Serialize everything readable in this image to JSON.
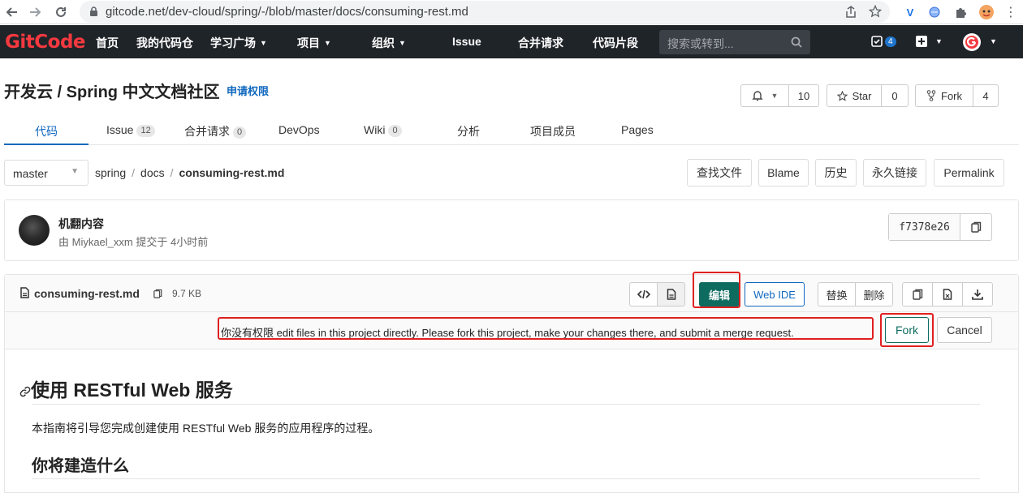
{
  "browser": {
    "url": "gitcode.net/dev-cloud/spring/-/blob/master/docs/consuming-rest.md"
  },
  "header": {
    "logo": "GitCode",
    "nav": [
      {
        "label": "首页",
        "dropdown": false
      },
      {
        "label": "我的代码仓",
        "dropdown": false
      },
      {
        "label": "学习广场",
        "dropdown": true
      },
      {
        "label": "项目",
        "dropdown": true
      },
      {
        "label": "组织",
        "dropdown": true
      },
      {
        "label": "Issue",
        "dropdown": false
      },
      {
        "label": "合并请求",
        "dropdown": false
      },
      {
        "label": "代码片段",
        "dropdown": false
      }
    ],
    "search_placeholder": "搜索或转到...",
    "todo_count": "4",
    "accent": "#1f2429"
  },
  "project": {
    "title": "开发云 / Spring 中文文档社区",
    "request_access": "申请权限",
    "notify_count": "10",
    "star_label": "Star",
    "star_count": "0",
    "fork_label": "Fork",
    "fork_count": "4"
  },
  "tabs": [
    {
      "label": "代码",
      "count": null,
      "active": true
    },
    {
      "label": "Issue",
      "count": "12"
    },
    {
      "label": "合并请求",
      "count": "0"
    },
    {
      "label": "DevOps",
      "count": null
    },
    {
      "label": "Wiki",
      "count": "0"
    },
    {
      "label": "分析",
      "count": null
    },
    {
      "label": "项目成员",
      "count": null
    },
    {
      "label": "Pages",
      "count": null
    }
  ],
  "file_nav": {
    "branch": "master",
    "crumbs": [
      "spring",
      "docs",
      "consuming-rest.md"
    ],
    "buttons": [
      "查找文件",
      "Blame",
      "历史",
      "永久链接",
      "Permalink"
    ]
  },
  "commit": {
    "title": "机翻内容",
    "meta": "由 Miykael_xxm 提交于 4小时前",
    "sha": "f7378e26"
  },
  "file": {
    "name": "consuming-rest.md",
    "size": "9.7 KB",
    "edit_label": "编辑",
    "webide_label": "Web IDE",
    "replace_label": "替换",
    "delete_label": "删除"
  },
  "fork_notice": {
    "message": "你没有权限 edit files in this project directly. Please fork this project, make your changes there, and submit a merge request.",
    "fork_label": "Fork",
    "cancel_label": "Cancel"
  },
  "content": {
    "h1": "使用 RESTful Web 服务",
    "paragraph": "本指南将引导您完成创建使用 RESTful Web 服务的应用程序的过程。",
    "h2": "你将建造什么"
  },
  "colors": {
    "primary_green": "#0d6b5f",
    "link_blue": "#1068bf",
    "highlight_red": "#e02020"
  }
}
